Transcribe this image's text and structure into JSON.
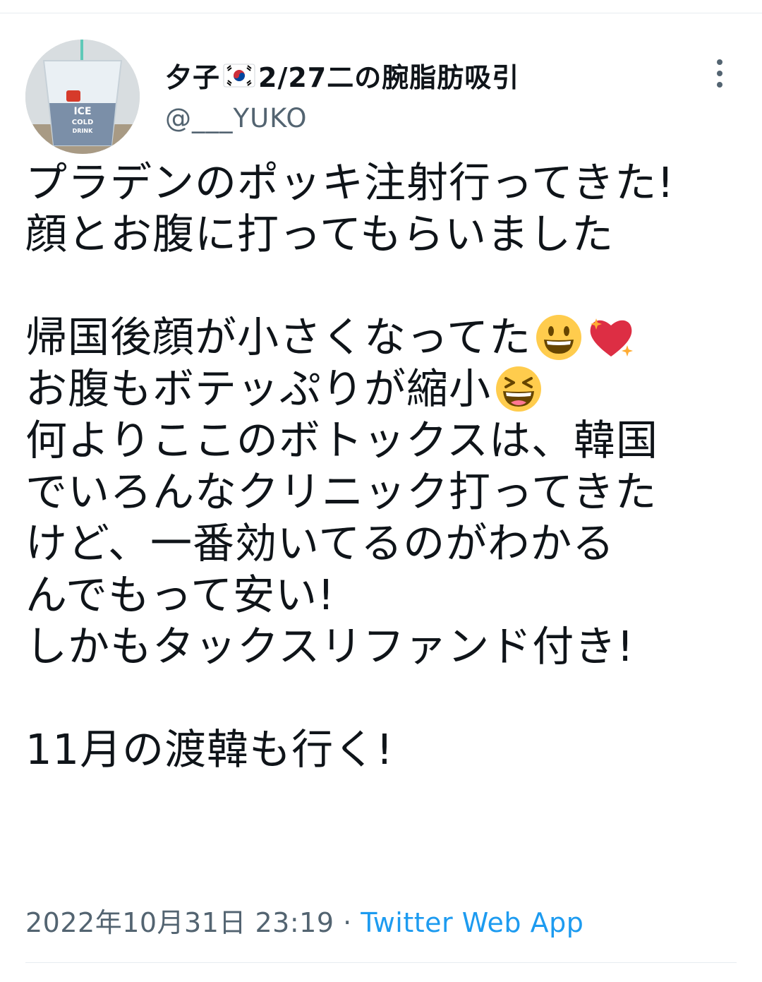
{
  "user": {
    "display_name_prefix": "夕子",
    "flag_icon": "south-korea-flag-icon",
    "display_name_suffix": "2/27二の腕脂肪吸引",
    "handle": "@___YUKO",
    "avatar_text": [
      "ICE",
      "COLD",
      "DRINK"
    ]
  },
  "tweet": {
    "line1": "プラデンのポッキ注射行ってきた!",
    "line2": "顔とお腹に打ってもらいました",
    "line3": "帰国後顔が小さくなってた",
    "line3_emojis": [
      "grinning-face-emoji",
      "sparkling-heart-emoji"
    ],
    "line4": "お腹もボテッぷりが縮小",
    "line4_emoji": "laughing-face-emoji",
    "line5": "何よりここのボトックスは、韓国",
    "line6": "でいろんなクリニック打ってきた",
    "line7": "けど、一番効いてるのがわかる",
    "line8": "んでもって安い!",
    "line9": "しかもタックスリファンド付き!",
    "line10": "11月の渡韓も行く!"
  },
  "meta": {
    "timestamp": "2022年10月31日 23:19",
    "separator": " · ",
    "source": "Twitter Web App"
  },
  "colors": {
    "text": "#0f1419",
    "secondary": "#536471",
    "link": "#1d9bf0",
    "divider": "#e6ecf0"
  }
}
